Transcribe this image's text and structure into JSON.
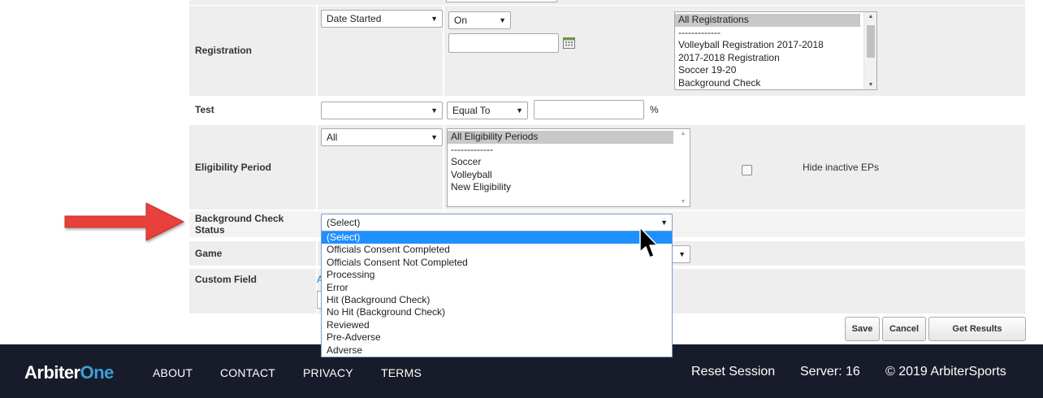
{
  "form": {
    "registration": {
      "label": "Registration",
      "date_type": "Date Started",
      "comparator": "On",
      "date_value": "",
      "list_options": [
        "All Registrations",
        "-------------",
        "Volleyball Registration 2017-2018",
        "2017-2018 Registration",
        "Soccer 19-20",
        "Background Check"
      ],
      "list_selected": "All Registrations"
    },
    "test": {
      "label": "Test",
      "test_value": "",
      "comparator": "Equal To",
      "score_value": "",
      "unit": "%"
    },
    "eligibility": {
      "label": "Eligibility Period",
      "filter": "All",
      "list_options": [
        "All Eligibility Periods",
        "-------------",
        "Soccer",
        "Volleyball",
        "New Eligibility"
      ],
      "list_selected": "All Eligibility Periods",
      "hide_inactive_label": "Hide inactive EPs",
      "hide_inactive_checked": false
    },
    "background_check": {
      "label": "Background Check Status",
      "selected": "(Select)",
      "options": [
        "(Select)",
        "Officials Consent Completed",
        "Officials Consent Not Completed",
        "Processing",
        "Error",
        "Hit (Background Check)",
        "No Hit (Background Check)",
        "Reviewed",
        "Pre-Adverse",
        "Adverse"
      ],
      "highlighted": "(Select)"
    },
    "game": {
      "label": "Game"
    },
    "custom_field": {
      "label": "Custom Field",
      "link_fragment": "A"
    }
  },
  "buttons": {
    "save": "Save",
    "cancel": "Cancel",
    "get_results": "Get Results"
  },
  "footer": {
    "logo_primary": "Arbiter",
    "logo_accent": "One",
    "nav": [
      "ABOUT",
      "CONTACT",
      "PRIVACY",
      "TERMS"
    ],
    "reset_session": "Reset Session",
    "server": "Server: 16",
    "copyright": "© 2019 ArbiterSports"
  },
  "icons": {
    "calendar": "calendar-icon",
    "arrow_annotation": "red-arrow",
    "cursor": "mouse-pointer"
  },
  "colors": {
    "row_background": "#eeeeee",
    "highlight": "#1e90ff",
    "footer_bg": "#181b29",
    "logo_accent": "#3aa0d8",
    "annotation_arrow": "#e8403a"
  }
}
